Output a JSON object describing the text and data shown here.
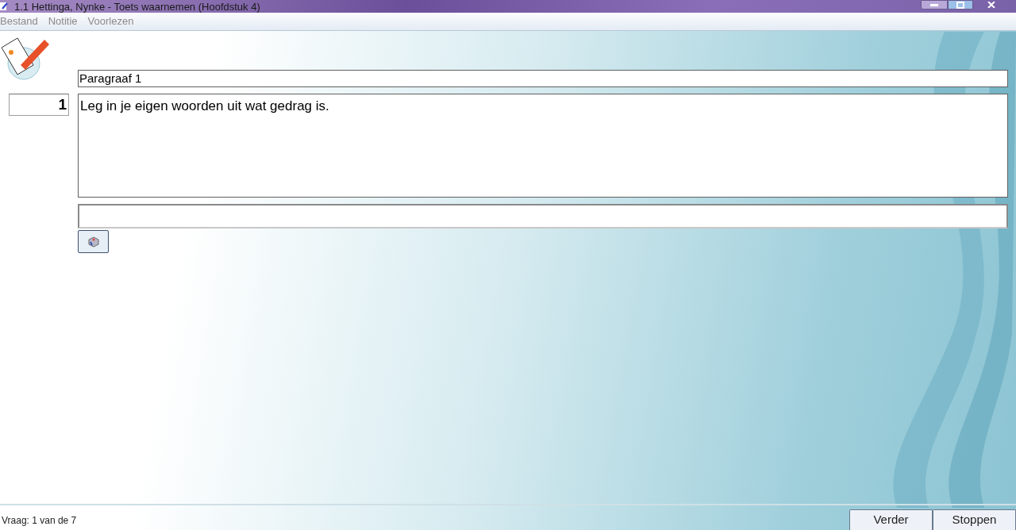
{
  "window": {
    "title": "1.1 Hettinga, Nynke - Toets waarnemen (Hoofdstuk 4)"
  },
  "menu": [
    {
      "label": "Bestand",
      "disabled": true
    },
    {
      "label": "Notitie",
      "disabled": true
    },
    {
      "label": "Voorlezen",
      "disabled": true
    }
  ],
  "question": {
    "number": "1",
    "section": "Paragraaf 1",
    "text": "Leg in je eigen woorden uit wat gedrag is."
  },
  "status_bar": {
    "text": "Vraag: 1 van de 7"
  },
  "buttons": [
    "Verder",
    "Stoppen"
  ]
}
